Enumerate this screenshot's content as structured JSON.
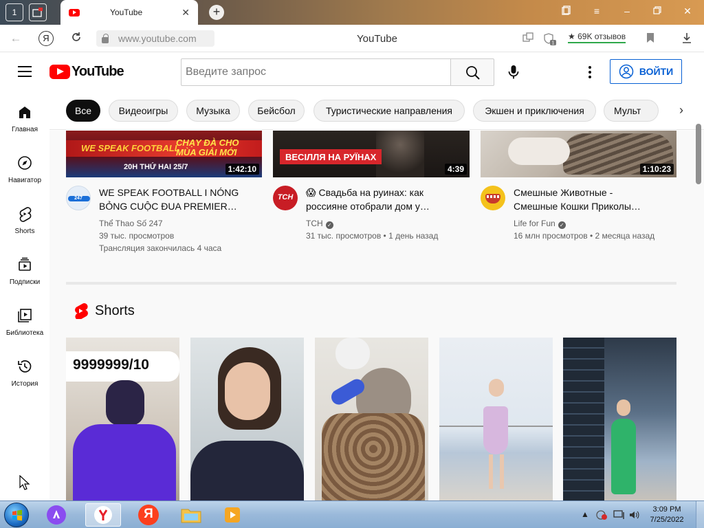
{
  "browser": {
    "tab_title": "YouTube",
    "tab_counter": "1",
    "url": "www.youtube.com",
    "page_title": "YouTube",
    "reviews": "★ 69K отзывов",
    "ya_label": "Я"
  },
  "header": {
    "logo_text": "YouTube",
    "search_placeholder": "Введите запрос",
    "login_label": "ВОЙТИ"
  },
  "chips": [
    "Все",
    "Видеоигры",
    "Музыка",
    "Бейсбол",
    "Туристические направления",
    "Экшен и приключения",
    "Мульт"
  ],
  "guide": [
    {
      "label": "Главная"
    },
    {
      "label": "Навигатор"
    },
    {
      "label": "Shorts"
    },
    {
      "label": "Подписки"
    },
    {
      "label": "Библиотека"
    },
    {
      "label": "История"
    }
  ],
  "videos": [
    {
      "thumb_text_1": "WE SPEAK FOOTBALL",
      "thumb_text_2": "CHẠY ĐÀ CHO MÙA GIẢI MỚI",
      "thumb_text_3": "20H THỨ HAI 25/7",
      "duration": "1:42:10",
      "avatar_text": "247",
      "title_line1": "WE SPEAK FOOTBALL I NÓNG",
      "title_line2": "BỎNG CUỘC ĐUA PREMIER…",
      "channel": "Thể Thao Số 247",
      "views": "39 тыс. просмотров",
      "age": "Трансляция закончилась 4 часа"
    },
    {
      "thumb_text_1": "ВЕСІЛЛЯ НА РУЇНАХ",
      "duration": "4:39",
      "avatar_text": "ТСН",
      "title_line1": "😱 Свадьба на руинах: как",
      "title_line2": "россияне отобрали дом у…",
      "channel": "ТСН",
      "views": "31 тыс. просмотров",
      "age": "1 день назад"
    },
    {
      "duration": "1:10:23",
      "title_line1": "Смешные Животные -",
      "title_line2": "Смешные Кошки Приколы…",
      "channel": "Life for Fun",
      "views": "16 млн просмотров",
      "age": "2 месяца назад"
    }
  ],
  "shorts": {
    "title": "Shorts",
    "first_overlay": "9999999/10"
  },
  "taskbar": {
    "time": "3:09 PM",
    "date": "7/25/2022",
    "yandex_label": "Я"
  },
  "colors": {
    "yt_red": "#ff0000",
    "link_blue": "#065fd4",
    "reviews_underline": "#2ea84a"
  }
}
